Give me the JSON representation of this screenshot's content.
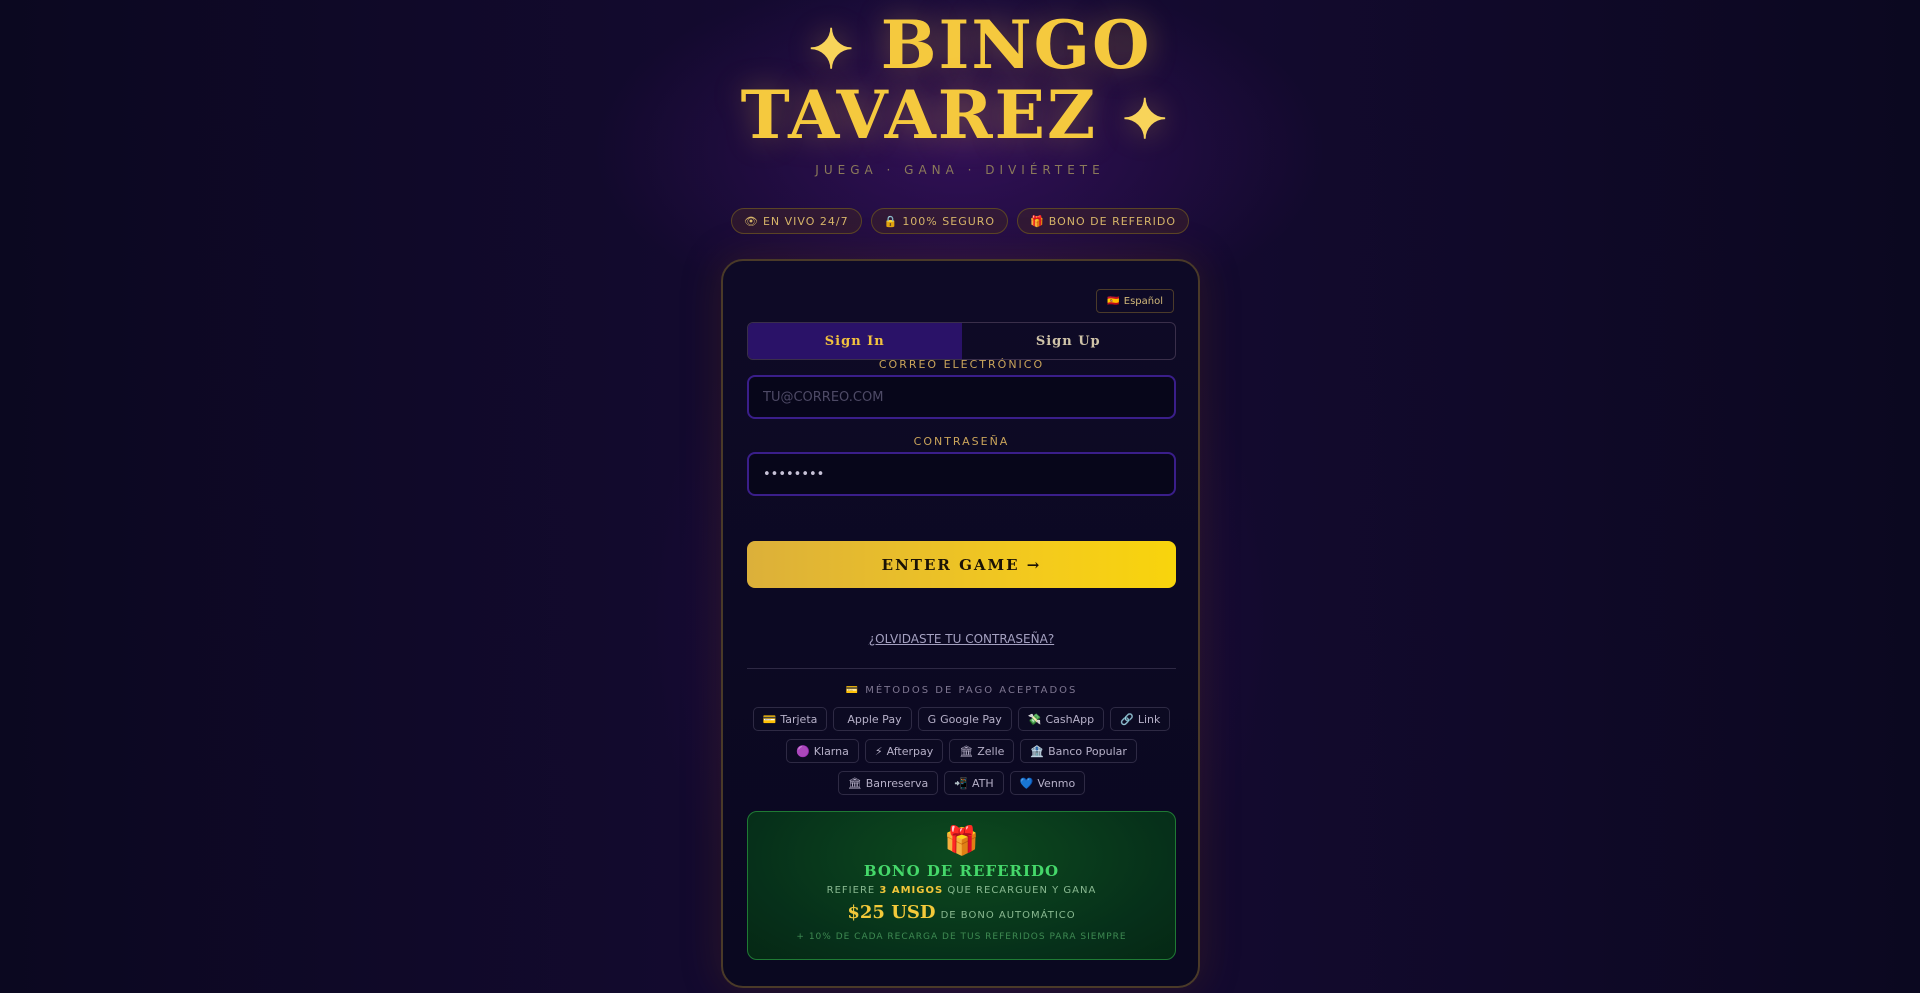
{
  "brand": {
    "line1": "BINGO",
    "line2": "TAVAREZ",
    "sparkle": "✦",
    "tagline": "JUEGA · GANA · DIVIÉRTETE"
  },
  "badges": [
    {
      "icon": "👁",
      "label": "EN VIVO 24/7"
    },
    {
      "icon": "🔒",
      "label": "100% SEGURO"
    },
    {
      "icon": "🎁",
      "label": "BONO DE REFERIDO"
    }
  ],
  "language": {
    "flag": "🇪🇸",
    "label": "Español"
  },
  "tabs": [
    {
      "label": "Sign In",
      "active": true
    },
    {
      "label": "Sign Up",
      "active": false
    }
  ],
  "form": {
    "email_label": "CORREO ELECTRÓNICO",
    "email_placeholder": "tu@correo.com",
    "email_value": "",
    "password_label": "CONTRASEÑA",
    "password_value": "••••••••",
    "submit_label": "ENTER GAME →",
    "forgot_label": "¿Olvidaste tu contraseña?"
  },
  "payments": {
    "title_icon": "💳",
    "title": "MÉTODOS DE PAGO ACEPTADOS",
    "rows": [
      [
        {
          "icon": "💳",
          "label": "Tarjeta"
        },
        {
          "icon": "",
          "label": "Apple Pay"
        },
        {
          "icon": "G",
          "label": "Google Pay"
        },
        {
          "icon": "💸",
          "label": "CashApp"
        },
        {
          "icon": "🔗",
          "label": "Link"
        }
      ],
      [
        {
          "icon": "🟣",
          "label": "Klarna"
        },
        {
          "icon": "⚡",
          "label": "Afterpay"
        },
        {
          "icon": "🏛",
          "label": "Zelle"
        },
        {
          "icon": "🏦",
          "label": "Banco Popular"
        }
      ],
      [
        {
          "icon": "🏛",
          "label": "Banreserva"
        },
        {
          "icon": "📲",
          "label": "ATH"
        },
        {
          "icon": "💙",
          "label": "Venmo"
        }
      ]
    ]
  },
  "bonus": {
    "icon": "🎁",
    "title": "BONO DE REFERIDO",
    "line_prefix": "Refiere",
    "line_bold": "3 amigos",
    "line_suffix": "que recarguen y gana",
    "amount": "$25 USD",
    "amount_suffix": "de bono automático",
    "note": "+ 10% de cada recarga de tus referidos para siempre"
  },
  "colors": {
    "accent_gold": "#f5c93e",
    "tab_active_bg": "#2a1268",
    "bonus_green": "#45d86a"
  }
}
